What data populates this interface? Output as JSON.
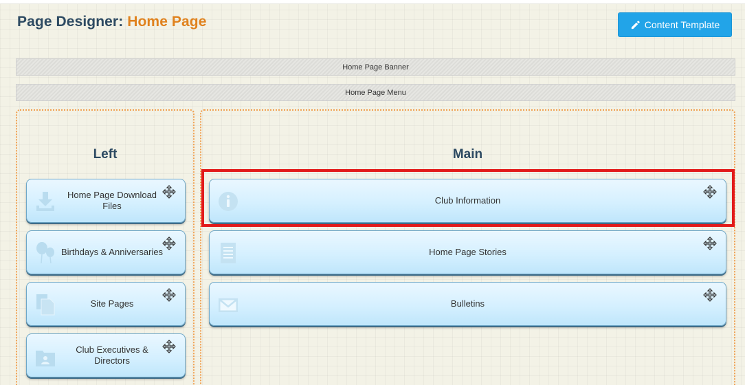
{
  "header": {
    "title_prefix": "Page Designer: ",
    "title_page": "Home Page",
    "template_button": "Content Template"
  },
  "strips": {
    "banner": "Home Page Banner",
    "menu": "Home Page Menu"
  },
  "zones": {
    "left": {
      "title": "Left",
      "widgets": [
        {
          "label": "Home Page Download Files",
          "icon": "download-icon"
        },
        {
          "label": "Birthdays & Anniversaries",
          "icon": "balloons-icon"
        },
        {
          "label": "Site Pages",
          "icon": "pages-icon"
        },
        {
          "label": "Club Executives & Directors",
          "icon": "folder-user-icon"
        }
      ]
    },
    "main": {
      "title": "Main",
      "widgets": [
        {
          "label": "Club Information",
          "icon": "info-icon",
          "highlighted": true
        },
        {
          "label": "Home Page Stories",
          "icon": "document-icon"
        },
        {
          "label": "Bulletins",
          "icon": "envelope-icon"
        }
      ]
    }
  },
  "colors": {
    "accent_orange": "#e0821e",
    "title_navy": "#2d4a62",
    "button_blue": "#22a4e8",
    "zone_border": "#f0a050",
    "highlight_red": "#e21a1a"
  }
}
